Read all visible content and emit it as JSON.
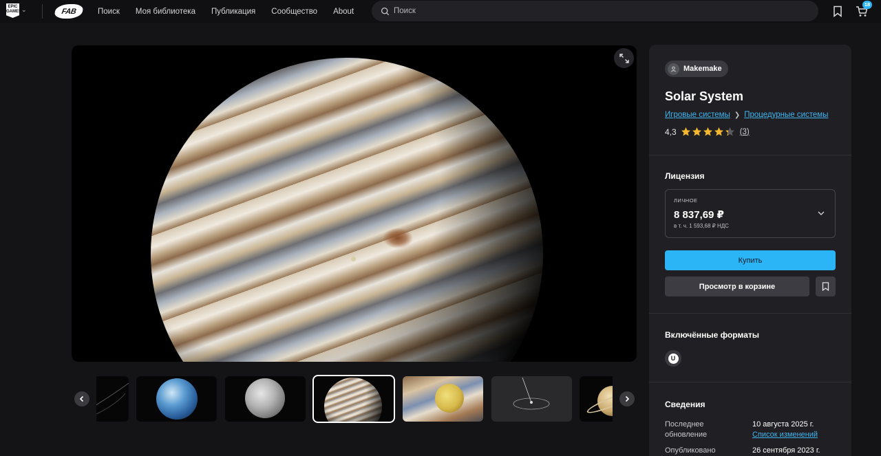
{
  "topbar": {
    "epic_logo_text": "EPIC GAMES",
    "fab_logo_text": "FAB",
    "nav": [
      "Поиск",
      "Моя библиотека",
      "Публикация",
      "Сообщество",
      "About"
    ],
    "search_placeholder": "Поиск",
    "cart_count": "18"
  },
  "product": {
    "author": "Makemake",
    "title": "Solar System",
    "breadcrumb": [
      "Игровые системы",
      "Процедурные системы"
    ],
    "rating": {
      "value_text": "4,3",
      "value": 4.3,
      "count_text": "(3)"
    }
  },
  "license": {
    "heading": "Лицензия",
    "tier": "ЛИЧНОЕ",
    "price": "8 837,69 ₽",
    "vat": "в т. ч. 1 593,68 ₽ НДС",
    "buy_label": "Купить",
    "cart_label": "Просмотр в корзине"
  },
  "formats": {
    "heading": "Включённые форматы",
    "items": [
      {
        "icon": "unreal-engine-icon",
        "glyph": "U"
      }
    ]
  },
  "details": {
    "heading": "Сведения",
    "rows": [
      {
        "label": "Последнее обновление",
        "value": "10 августа 2025 г.",
        "link": "Список изменений"
      },
      {
        "label": "Опубликовано",
        "value": "26 сентября 2023 г."
      }
    ]
  },
  "gallery": {
    "selected_index": 3,
    "thumbnails": [
      "orbit-lines",
      "earth",
      "moon",
      "jupiter",
      "io-over-jupiter",
      "orbit-diagram",
      "saturn"
    ]
  },
  "colors": {
    "accent": "#2bb5f6",
    "link": "#3fb5f0",
    "star": "#f5b82e",
    "background": "#141417",
    "panel": "#202024"
  }
}
